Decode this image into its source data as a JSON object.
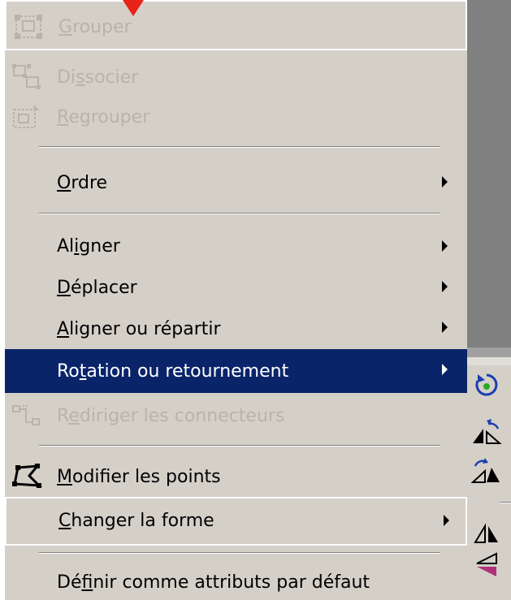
{
  "menu": {
    "items": [
      {
        "id": "grouper",
        "pre": "",
        "ul": "G",
        "post": "rouper",
        "disabled": true,
        "icon": "group-icon"
      },
      {
        "id": "dissocier",
        "pre": "Di",
        "ul": "s",
        "post": "socier",
        "disabled": true,
        "icon": "ungroup-icon"
      },
      {
        "id": "regrouper",
        "pre": "",
        "ul": "R",
        "post": "egrouper",
        "disabled": true,
        "icon": "regroup-icon"
      },
      {
        "id": "ordre",
        "pre": "",
        "ul": "O",
        "post": "rdre",
        "submenu": true
      },
      {
        "id": "aligner",
        "pre": "Al",
        "ul": "i",
        "post": "gner",
        "submenu": true
      },
      {
        "id": "deplacer",
        "pre": "",
        "ul": "D",
        "post": "éplacer",
        "submenu": true
      },
      {
        "id": "aligner-repartir",
        "pre": "",
        "ul": "A",
        "post": "ligner ou répartir",
        "submenu": true
      },
      {
        "id": "rotation",
        "pre": "Ro",
        "ul": "t",
        "post": "ation ou retournement",
        "submenu": true,
        "highlighted": true
      },
      {
        "id": "rediriger",
        "pre": "R",
        "ul": "e",
        "post": "diriger les connecteurs",
        "disabled": true,
        "icon": "reroute-connectors-icon"
      },
      {
        "id": "modifier-points",
        "pre": "",
        "ul": "M",
        "post": "odifier les points",
        "icon": "edit-points-icon"
      },
      {
        "id": "changer-forme",
        "pre": "",
        "ul": "C",
        "post": "hanger la forme",
        "submenu": true
      },
      {
        "id": "definir",
        "pre": "Dé",
        "ul": "f",
        "post": "inir comme attributs par défaut"
      }
    ]
  },
  "submenu_icons": [
    "free-rotate-icon",
    "rotate-left-icon",
    "rotate-right-icon",
    "flip-horizontal-icon",
    "flip-vertical-icon"
  ],
  "colors": {
    "menu_bg": "#d4d0c8",
    "highlight": "#0a246a",
    "disabled_text": "#b8b4ac",
    "pointer_arrow": "#e8231a"
  }
}
